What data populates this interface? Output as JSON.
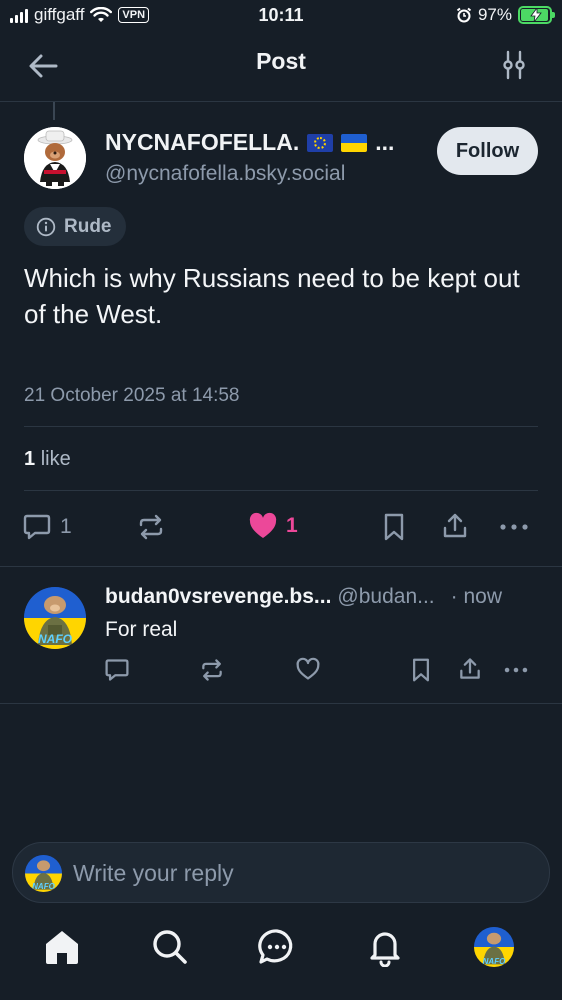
{
  "status_bar": {
    "carrier": "giffgaff",
    "vpn": "VPN",
    "time": "10:11",
    "battery": "97%"
  },
  "header": {
    "title": "Post",
    "back_icon": "arrow-left-icon",
    "settings_icon": "sliders-icon"
  },
  "post": {
    "author_name": "NYCNAFOFELLA.",
    "author_suffix": "...",
    "author_handle": "@nycnafofella.bsky.social",
    "follow_label": "Follow",
    "label": "Rude",
    "text": "Which is why Russians need to be kept out of the West.",
    "date": "21 October 2025 at 14:58",
    "likes_count": "1",
    "likes_label": "like",
    "actions": {
      "reply_count": "1",
      "like_count": "1"
    }
  },
  "reply": {
    "author_name": "budan0vsrevenge.bs...",
    "author_handle": "@budan...",
    "time": "· now",
    "text": "For real",
    "avatar_text": "NAFO"
  },
  "composer": {
    "placeholder": "Write your reply",
    "avatar_text": "NAFO"
  },
  "tabbar": {
    "items": [
      "home-icon",
      "search-icon",
      "chat-icon",
      "bell-icon",
      "profile-avatar"
    ],
    "avatar_text": "NAFO"
  },
  "colors": {
    "background": "#161e27",
    "like_pink": "#ec4899",
    "muted": "#8d9aab",
    "battery_green": "#4cd964"
  }
}
